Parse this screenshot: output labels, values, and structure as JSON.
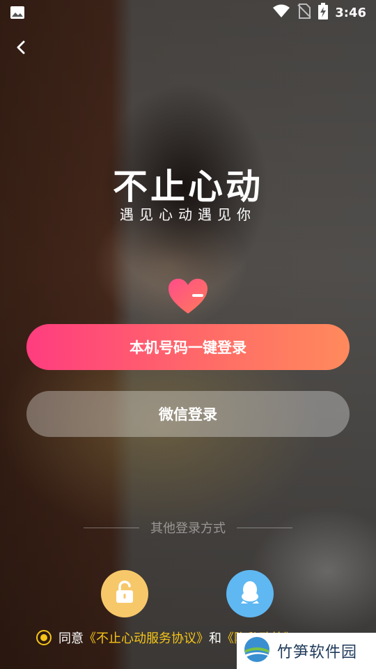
{
  "status_bar": {
    "time": "3:46",
    "icons": [
      "gallery-icon",
      "wifi-icon",
      "no-sim-icon",
      "battery-charging-icon"
    ]
  },
  "nav": {
    "back_icon": "chevron-left-icon"
  },
  "brand": {
    "title": "不止心动",
    "subtitle": "遇见心动遇见你",
    "logo_icon": "heart-icon"
  },
  "buttons": {
    "phone_login": "本机号码一键登录",
    "wechat_login": "微信登录"
  },
  "other_login": {
    "label": "其他登录方式",
    "options": [
      {
        "icon": "lock-icon",
        "color": "#f7c86a"
      },
      {
        "icon": "qq-icon",
        "color": "#5fb8f2"
      }
    ]
  },
  "agreement": {
    "prefix": "同意",
    "terms": "《不止心动服务协议》",
    "conjunction": "和",
    "privacy": "《隐私政策》"
  },
  "watermark": {
    "text": "竹笋软件园"
  },
  "colors": {
    "primary_gradient_start": "#ff3d7f",
    "primary_gradient_end": "#ff8a5c",
    "accent_yellow": "#f5c518"
  }
}
